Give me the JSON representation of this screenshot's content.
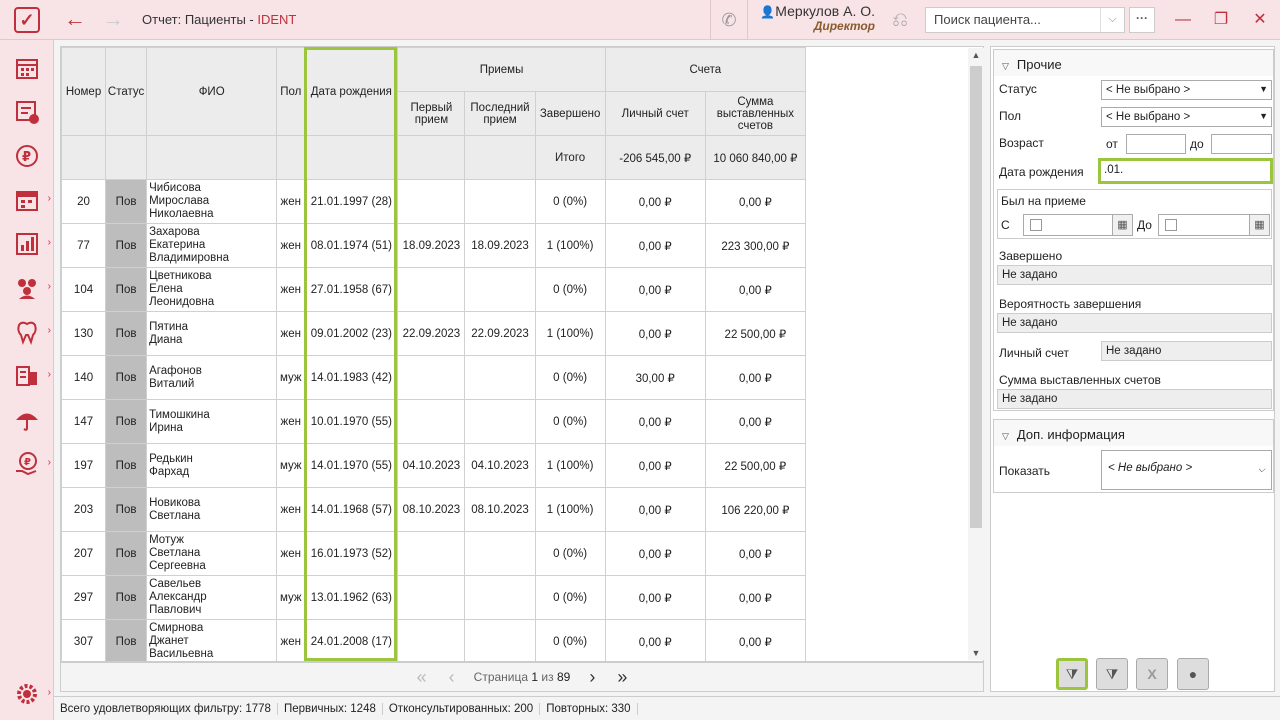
{
  "title": {
    "prefix": "Отчет: Пациенты",
    "separator": " - ",
    "app": "IDENT"
  },
  "user": {
    "name": "Меркулов А. О.",
    "role": "Директор"
  },
  "search": {
    "placeholder": "Поиск пациента..."
  },
  "colors": {
    "accent": "#c0303c",
    "highlight": "#9bc53d",
    "sidebar": "#f8e4e6"
  },
  "icons": {
    "sidebar": [
      "schedule-icon",
      "visits-icon",
      "ruble-icon",
      "calendar-icon",
      "reports-icon",
      "staff-icon",
      "tooth-icon",
      "lab-icon",
      "insurance-icon",
      "payments-icon",
      "settings-icon"
    ]
  },
  "table": {
    "headers": {
      "number": "Номер",
      "status": "Статус",
      "fio": "ФИО",
      "sex": "Пол",
      "dob": "Дата рождения",
      "visits": "Приемы",
      "accounts": "Счета",
      "first": "Первый прием",
      "last": "Последний прием",
      "completed": "Завершено",
      "personal": "Личный счет",
      "billed": "Сумма выставленных счетов"
    },
    "totals": {
      "label": "Итого",
      "personal": "-206 545,00 ₽",
      "billed": "10 060 840,00 ₽"
    },
    "rows": [
      {
        "num": "20",
        "status": "Пов",
        "fio": "Чибисова Мирослава Николаевна",
        "sex": "жен",
        "dob": "21.01.1997 (28)",
        "first": "",
        "last": "",
        "completed": "0 (0%)",
        "personal": "0,00 ₽",
        "billed": "0,00 ₽"
      },
      {
        "num": "77",
        "status": "Пов",
        "fio": "Захарова Екатерина Владимировна",
        "sex": "жен",
        "dob": "08.01.1974 (51)",
        "first": "18.09.2023",
        "last": "18.09.2023",
        "completed": "1 (100%)",
        "personal": "0,00 ₽",
        "billed": "223 300,00 ₽"
      },
      {
        "num": "104",
        "status": "Пов",
        "fio": "Цветникова Елена Леонидовна",
        "sex": "жен",
        "dob": "27.01.1958 (67)",
        "first": "",
        "last": "",
        "completed": "0 (0%)",
        "personal": "0,00 ₽",
        "billed": "0,00 ₽"
      },
      {
        "num": "130",
        "status": "Пов",
        "fio": "Пятина Диана",
        "sex": "жен",
        "dob": "09.01.2002 (23)",
        "first": "22.09.2023",
        "last": "22.09.2023",
        "completed": "1 (100%)",
        "personal": "0,00 ₽",
        "billed": "22 500,00 ₽"
      },
      {
        "num": "140",
        "status": "Пов",
        "fio": "Агафонов Виталий",
        "sex": "муж",
        "dob": "14.01.1983 (42)",
        "first": "",
        "last": "",
        "completed": "0 (0%)",
        "personal": "30,00 ₽",
        "billed": "0,00 ₽"
      },
      {
        "num": "147",
        "status": "Пов",
        "fio": "Тимошкина Ирина",
        "sex": "жен",
        "dob": "10.01.1970 (55)",
        "first": "",
        "last": "",
        "completed": "0 (0%)",
        "personal": "0,00 ₽",
        "billed": "0,00 ₽"
      },
      {
        "num": "197",
        "status": "Пов",
        "fio": "Редькин Фархад",
        "sex": "муж",
        "dob": "14.01.1970 (55)",
        "first": "04.10.2023",
        "last": "04.10.2023",
        "completed": "1 (100%)",
        "personal": "0,00 ₽",
        "billed": "22 500,00 ₽"
      },
      {
        "num": "203",
        "status": "Пов",
        "fio": "Новикова Светлана",
        "sex": "жен",
        "dob": "14.01.1968 (57)",
        "first": "08.10.2023",
        "last": "08.10.2023",
        "completed": "1 (100%)",
        "personal": "0,00 ₽",
        "billed": "106 220,00 ₽"
      },
      {
        "num": "207",
        "status": "Пов",
        "fio": "Мотуж Светлана Сергеевна",
        "sex": "жен",
        "dob": "16.01.1973 (52)",
        "first": "",
        "last": "",
        "completed": "0 (0%)",
        "personal": "0,00 ₽",
        "billed": "0,00 ₽"
      },
      {
        "num": "297",
        "status": "Пов",
        "fio": "Савельев Александр Павлович",
        "sex": "муж",
        "dob": "13.01.1962 (63)",
        "first": "",
        "last": "",
        "completed": "0 (0%)",
        "personal": "0,00 ₽",
        "billed": "0,00 ₽"
      },
      {
        "num": "307",
        "status": "Пов",
        "fio": "Смирнова Джанет Васильевна",
        "sex": "жен",
        "dob": "24.01.2008 (17)",
        "first": "",
        "last": "",
        "completed": "0 (0%)",
        "personal": "0,00 ₽",
        "billed": "0,00 ₽"
      }
    ]
  },
  "pager": {
    "prefix": "Страница",
    "page": "1",
    "of": "из",
    "total": "89"
  },
  "status": {
    "total": "Всего удовлетворяющих фильтру: 1778",
    "primary": "Первичных: 1248",
    "consulted": "Отконсультированных: 200",
    "repeat": "Повторных: 330"
  },
  "filters": {
    "other_title": "Прочие",
    "status_label": "Статус",
    "status_value": "< Не выбрано >",
    "sex_label": "Пол",
    "sex_value": "< Не выбрано >",
    "age_label": "Возраст",
    "age_from": "от",
    "age_to": "до",
    "dob_label": "Дата рождения",
    "dob_value": ".01.",
    "visited_label": "Был на приеме",
    "visited_from": "С",
    "visited_to": "До",
    "completed_label": "Завершено",
    "completed_value": "Не задано",
    "probability_label": "Вероятность завершения",
    "probability_value": "Не задано",
    "personal_label": "Личный счет",
    "personal_value": "Не задано",
    "billed_label": "Сумма выставленных счетов",
    "billed_value": "Не задано",
    "extra_title": "Доп. информация",
    "show_label": "Показать",
    "show_value": "< Не выбрано >"
  }
}
